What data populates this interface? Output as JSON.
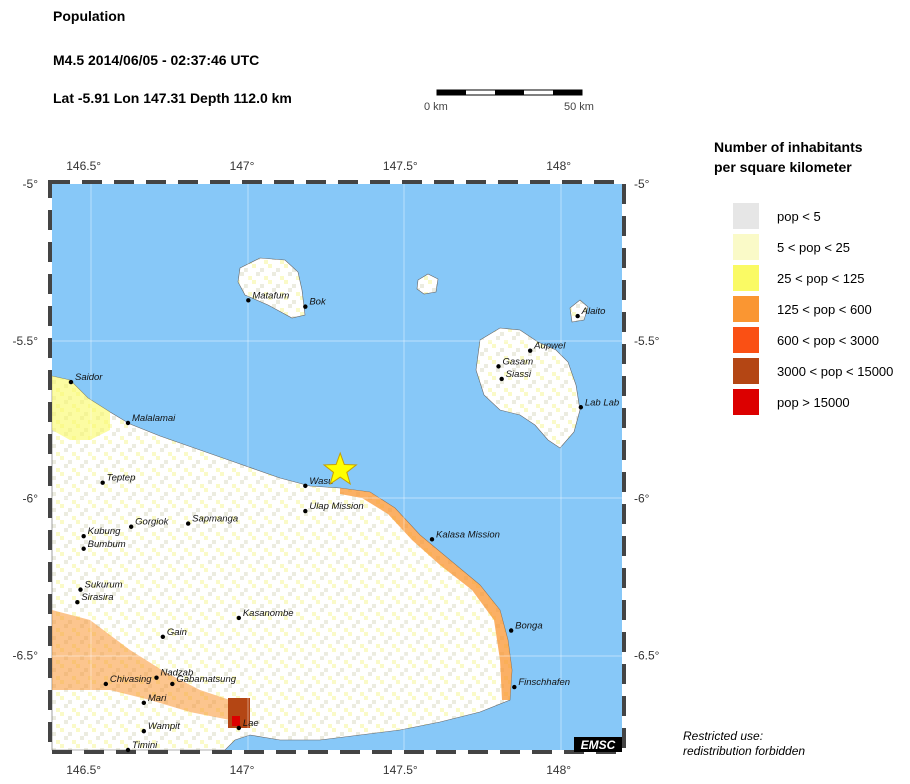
{
  "header": {
    "title": "Population",
    "event": "M4.5  2014/06/05 - 02:37:46 UTC",
    "coords": "Lat -5.91     Lon 147.31     Depth 112.0 km"
  },
  "scale_bar": {
    "start_label": "0 km",
    "end_label": "50 km"
  },
  "map": {
    "lon_range": [
      146.4,
      148.2
    ],
    "lat_range": [
      -5.0,
      -6.8
    ],
    "ocean_color": "#87c8f8",
    "lon_ticks": [
      {
        "value": 146.5,
        "label": "146.5°"
      },
      {
        "value": 147.0,
        "label": "147°"
      },
      {
        "value": 147.5,
        "label": "147.5°"
      },
      {
        "value": 148.0,
        "label": "148°"
      }
    ],
    "lat_ticks": [
      {
        "value": -5.0,
        "label": "-5°"
      },
      {
        "value": -5.5,
        "label": "-5.5°"
      },
      {
        "value": -6.0,
        "label": "-6°"
      },
      {
        "value": -6.5,
        "label": "-6.5°"
      }
    ],
    "epicenter": {
      "lon": 147.31,
      "lat": -5.91,
      "symbol": "star",
      "color": "#ffff00"
    },
    "credit": "EMSC",
    "places": [
      {
        "name": "Matafum",
        "lon": 147.02,
        "lat": -5.37
      },
      {
        "name": "Bok",
        "lon": 147.2,
        "lat": -5.39
      },
      {
        "name": "Alaito",
        "lon": 148.06,
        "lat": -5.42
      },
      {
        "name": "Aupwel",
        "lon": 147.91,
        "lat": -5.53
      },
      {
        "name": "Gasam",
        "lon": 147.81,
        "lat": -5.58
      },
      {
        "name": "Siassi",
        "lon": 147.82,
        "lat": -5.62
      },
      {
        "name": "Lab Lab",
        "lon": 148.07,
        "lat": -5.71
      },
      {
        "name": "Saidor",
        "lon": 146.46,
        "lat": -5.63
      },
      {
        "name": "Malalamai",
        "lon": 146.64,
        "lat": -5.76
      },
      {
        "name": "Teptep",
        "lon": 146.56,
        "lat": -5.95
      },
      {
        "name": "Wasu",
        "lon": 147.2,
        "lat": -5.96
      },
      {
        "name": "Ulap Mission",
        "lon": 147.2,
        "lat": -6.04
      },
      {
        "name": "Gorgiok",
        "lon": 146.65,
        "lat": -6.09
      },
      {
        "name": "Sapmanga",
        "lon": 146.83,
        "lat": -6.08
      },
      {
        "name": "Kubung",
        "lon": 146.5,
        "lat": -6.12
      },
      {
        "name": "Bumbum",
        "lon": 146.5,
        "lat": -6.16
      },
      {
        "name": "Kalasa Mission",
        "lon": 147.6,
        "lat": -6.13
      },
      {
        "name": "Sukurum",
        "lon": 146.49,
        "lat": -6.29
      },
      {
        "name": "Sirasira",
        "lon": 146.48,
        "lat": -6.33
      },
      {
        "name": "Kasanombe",
        "lon": 146.99,
        "lat": -6.38
      },
      {
        "name": "Bonga",
        "lon": 147.85,
        "lat": -6.42
      },
      {
        "name": "Gain",
        "lon": 146.75,
        "lat": -6.44
      },
      {
        "name": "Nadzab",
        "lon": 146.73,
        "lat": -6.57
      },
      {
        "name": "Chivasing",
        "lon": 146.57,
        "lat": -6.59
      },
      {
        "name": "Gabamatsung",
        "lon": 146.78,
        "lat": -6.59
      },
      {
        "name": "Finschhafen",
        "lon": 147.86,
        "lat": -6.6
      },
      {
        "name": "Mari",
        "lon": 146.69,
        "lat": -6.65
      },
      {
        "name": "Lae",
        "lon": 146.99,
        "lat": -6.73
      },
      {
        "name": "Wampit",
        "lon": 146.69,
        "lat": -6.74
      },
      {
        "name": "Timini",
        "lon": 146.64,
        "lat": -6.8
      }
    ]
  },
  "legend": {
    "title_line1": "Number of inhabitants",
    "title_line2": "per square kilometer",
    "items": [
      {
        "label": "pop < 5",
        "color": "#e6e6e6"
      },
      {
        "label": "5 < pop < 25",
        "color": "#fafac8"
      },
      {
        "label": "25 < pop < 125",
        "color": "#fafa64"
      },
      {
        "label": "125 < pop < 600",
        "color": "#fa9632"
      },
      {
        "label": "600 < pop < 3000",
        "color": "#fa5014"
      },
      {
        "label": "3000 < pop < 15000",
        "color": "#b44614"
      },
      {
        "label": "pop > 15000",
        "color": "#dc0000"
      }
    ]
  },
  "notice": {
    "line1": "Restricted use:",
    "line2": "redistribution forbidden"
  }
}
